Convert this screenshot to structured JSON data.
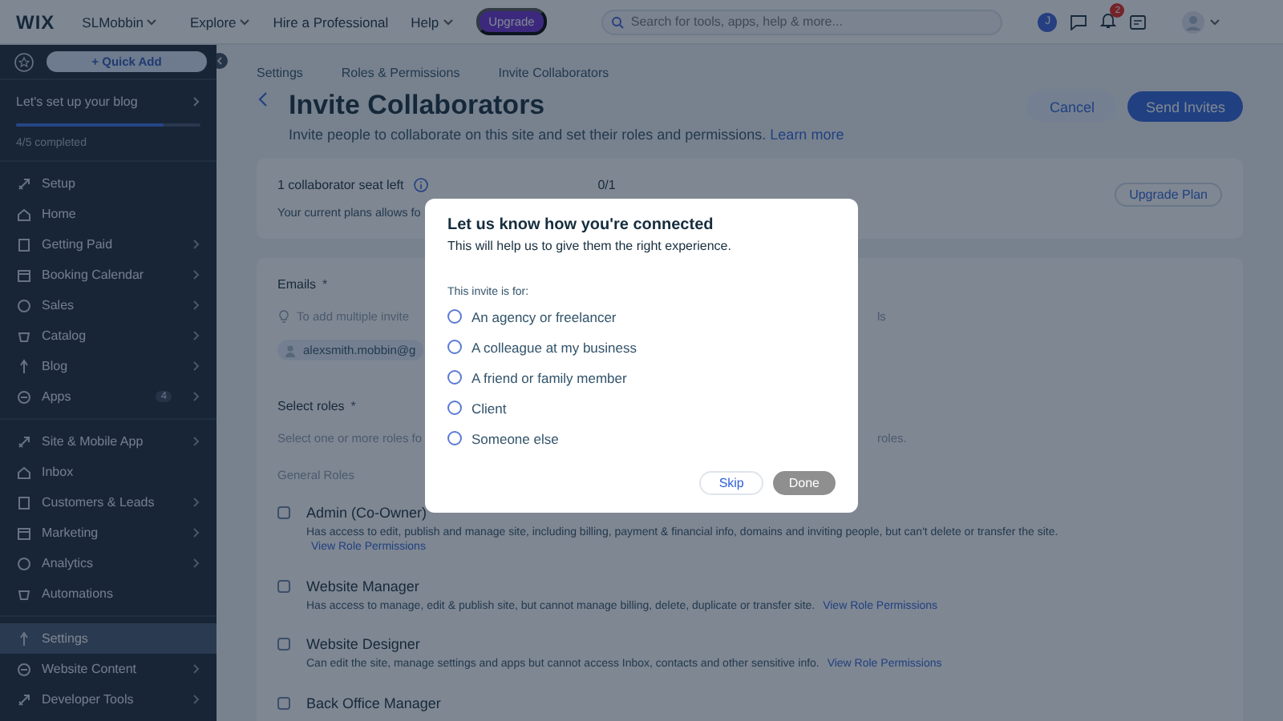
{
  "topbar": {
    "logo": "WIX",
    "site": "SLMobbin",
    "nav": [
      {
        "label": "Explore",
        "dropdown": true
      },
      {
        "label": "Hire a Professional",
        "dropdown": false
      },
      {
        "label": "Help",
        "dropdown": true
      }
    ],
    "upgrade": "Upgrade",
    "search": {
      "placeholder": "Search for tools, apps, help & more..."
    },
    "user_initial": "J",
    "notification_count": "2"
  },
  "sidebar": {
    "quick_add": "+ Quick Add",
    "setup": {
      "title": "Let's set up your blog",
      "level": 0.8,
      "progress": "4/5 completed"
    },
    "groups": [
      [
        {
          "label": "Setup",
          "arrow": false,
          "selected": false
        },
        {
          "label": "Home",
          "arrow": false,
          "selected": false
        },
        {
          "label": "Getting Paid",
          "arrow": true,
          "selected": false
        },
        {
          "label": "Booking Calendar",
          "arrow": true,
          "selected": false
        },
        {
          "label": "Sales",
          "arrow": true,
          "selected": false
        },
        {
          "label": "Catalog",
          "arrow": true,
          "selected": false
        },
        {
          "label": "Blog",
          "arrow": true,
          "selected": false
        },
        {
          "label": "Apps",
          "arrow": true,
          "selected": false,
          "badge": "4"
        }
      ],
      [
        {
          "label": "Site & Mobile App",
          "arrow": true,
          "selected": false
        },
        {
          "label": "Inbox",
          "arrow": false,
          "selected": false
        },
        {
          "label": "Customers & Leads",
          "arrow": true,
          "selected": false
        },
        {
          "label": "Marketing",
          "arrow": true,
          "selected": false
        },
        {
          "label": "Analytics",
          "arrow": true,
          "selected": false
        },
        {
          "label": "Automations",
          "arrow": false,
          "selected": false
        }
      ],
      [
        {
          "label": "Settings",
          "arrow": false,
          "selected": true
        },
        {
          "label": "Website Content",
          "arrow": true,
          "selected": false
        },
        {
          "label": "Developer Tools",
          "arrow": true,
          "selected": false
        }
      ]
    ]
  },
  "breadcrumbs": [
    "Settings",
    "Roles & Permissions",
    "Invite Collaborators"
  ],
  "header": {
    "title": "Invite Collaborators",
    "subtitle": "Invite people to collaborate on this site and set their roles and permissions.",
    "learn_more": "Learn more",
    "cancel": "Cancel",
    "send": "Send Invites"
  },
  "seats": {
    "title": "1 collaborator seat left",
    "count": "0/1",
    "note": "Your current plans allows fo",
    "upgrade": "Upgrade Plan"
  },
  "emails": {
    "label": "Emails",
    "required": "*",
    "hint": "To add multiple invite",
    "hint_end": "ls",
    "chip": "alexsmith.mobbin@g"
  },
  "roles": {
    "label": "Select roles",
    "required": "*",
    "hint": "Select one or more roles fo",
    "hint_end": "roles.",
    "group": "General Roles",
    "items": [
      {
        "name": "Admin (Co-Owner)",
        "checked": false,
        "description": "Has access to edit, publish and manage site, including billing, payment & financial info, domains and inviting people, but can't delete or transfer the site.",
        "link": "View Role Permissions"
      },
      {
        "name": "Website Manager",
        "checked": false,
        "description": "Has access to manage, edit & publish site, but cannot manage billing, delete, duplicate or transfer site.",
        "link": "View Role Permissions"
      },
      {
        "name": "Website Designer",
        "checked": false,
        "description": "Can edit the site, manage settings and apps but cannot access Inbox, contacts and other sensitive info.",
        "link": "View Role Permissions"
      },
      {
        "name": "Back Office Manager",
        "checked": false
      }
    ]
  },
  "modal": {
    "title": "Let us know how you're connected",
    "subtitle": "This will help us to give them the right experience.",
    "question": "This invite is for:",
    "options": [
      {
        "label": "An agency or freelancer",
        "selected": false
      },
      {
        "label": "A colleague at my business",
        "selected": false
      },
      {
        "label": "A friend or family member",
        "selected": false
      },
      {
        "label": "Client",
        "selected": false
      },
      {
        "label": "Someone else",
        "selected": false
      }
    ],
    "skip": "Skip",
    "done": {
      "label": "Done",
      "disabled": true
    }
  }
}
